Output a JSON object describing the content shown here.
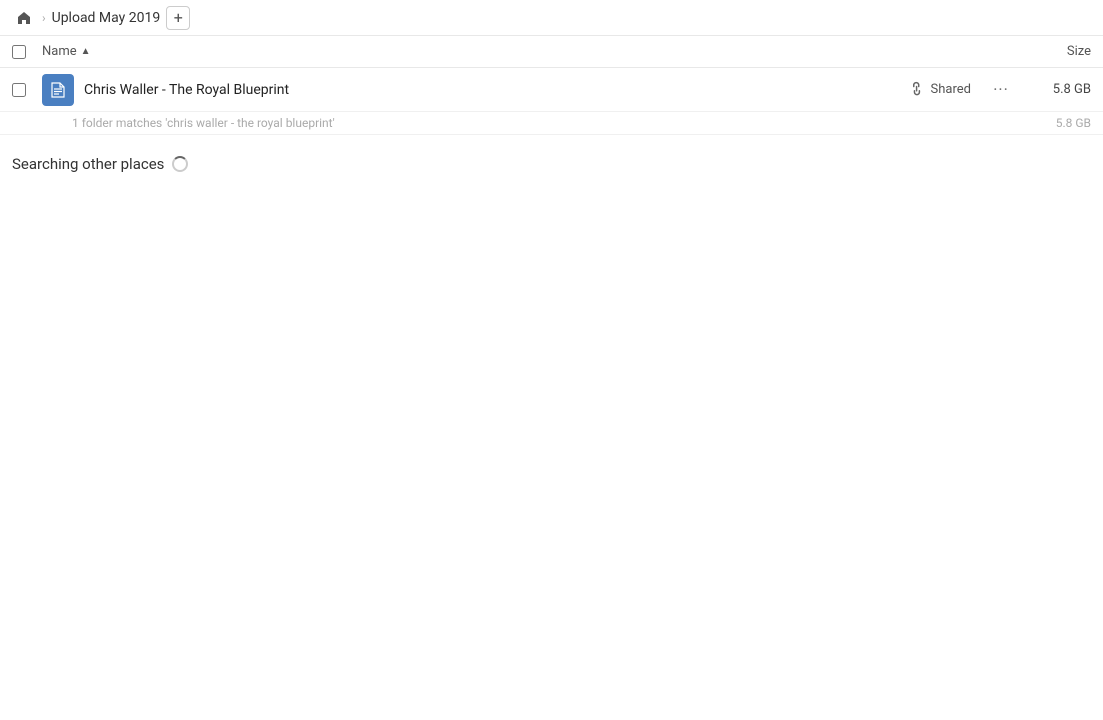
{
  "header": {
    "home_label": "Home",
    "breadcrumb_label": "Upload May 2019",
    "add_button_label": "+"
  },
  "columns": {
    "name_label": "Name",
    "sort_arrow": "▲",
    "size_label": "Size"
  },
  "file_row": {
    "icon_symbol": "✎",
    "name": "Chris Waller - The Royal Blueprint",
    "shared_label": "Shared",
    "more_label": "···",
    "size": "5.8 GB"
  },
  "match_hint": {
    "text": "1 folder matches 'chris waller - the royal blueprint'",
    "size": "5.8 GB"
  },
  "searching": {
    "text": "Searching other places"
  }
}
